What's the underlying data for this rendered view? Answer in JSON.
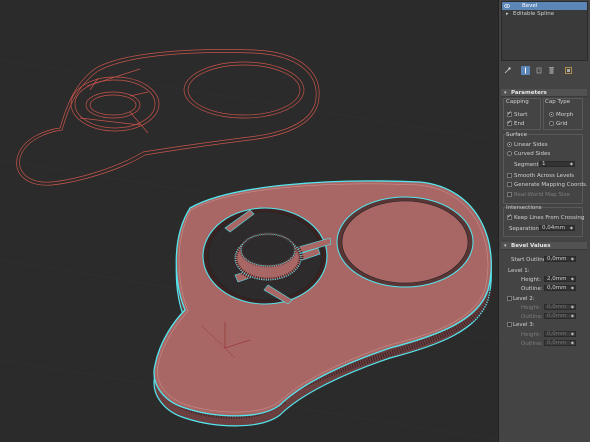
{
  "modifier_stack": {
    "items": [
      {
        "label": "Bevel",
        "selected": true
      },
      {
        "label": "Editable Spline",
        "selected": false
      }
    ]
  },
  "toolbar": {
    "icons": [
      "pin-stack-icon",
      "show-end-result-icon",
      "make-unique-icon",
      "remove-modifier-icon",
      "configure-sets-icon"
    ]
  },
  "parameters": {
    "title": "Parameters",
    "capping": {
      "title": "Capping",
      "start": "Start",
      "end": "End",
      "start_checked": true,
      "end_checked": true
    },
    "cap_type": {
      "title": "Cap Type",
      "morph": "Morph",
      "grid": "Grid",
      "selected": "Morph"
    },
    "surface": {
      "title": "Surface",
      "linear_sides": "Linear Sides",
      "curved_sides": "Curved Sides",
      "segments_label": "Segments:",
      "segments_value": "1",
      "smooth_across_levels": "Smooth Across Levels",
      "generate_mapping": "Generate Mapping Coords.",
      "real_world_map": "Real-World Map Size"
    },
    "intersections": {
      "title": "Intersections",
      "keep_lines": "Keep Lines From Crossing",
      "separation_label": "Separation:",
      "separation_value": "0,04mm"
    }
  },
  "bevel_values": {
    "title": "Bevel Values",
    "start_outline_label": "Start Outline:",
    "start_outline_value": "0,0mm",
    "level1": {
      "title": "Level 1:",
      "height_label": "Height:",
      "height_value": "2,0mm",
      "outline_label": "Outline:",
      "outline_value": "0,0mm"
    },
    "level2": {
      "title": "Level 2:",
      "height_label": "Height:",
      "height_value": "0,0mm",
      "outline_label": "Outline:",
      "outline_value": "0,0mm"
    },
    "level3": {
      "title": "Level 3:",
      "height_label": "Height:",
      "height_value": "0,0mm",
      "outline_label": "Outline:",
      "outline_value": "0,0mm"
    }
  },
  "colors": {
    "viewport_bg": "#2b2b2b",
    "spline": "#c8544a",
    "selection_outline": "#53e6ee",
    "mesh_face": "#a86764",
    "mesh_side": "#6b3f40",
    "selection_blue": "#5d86b8"
  }
}
